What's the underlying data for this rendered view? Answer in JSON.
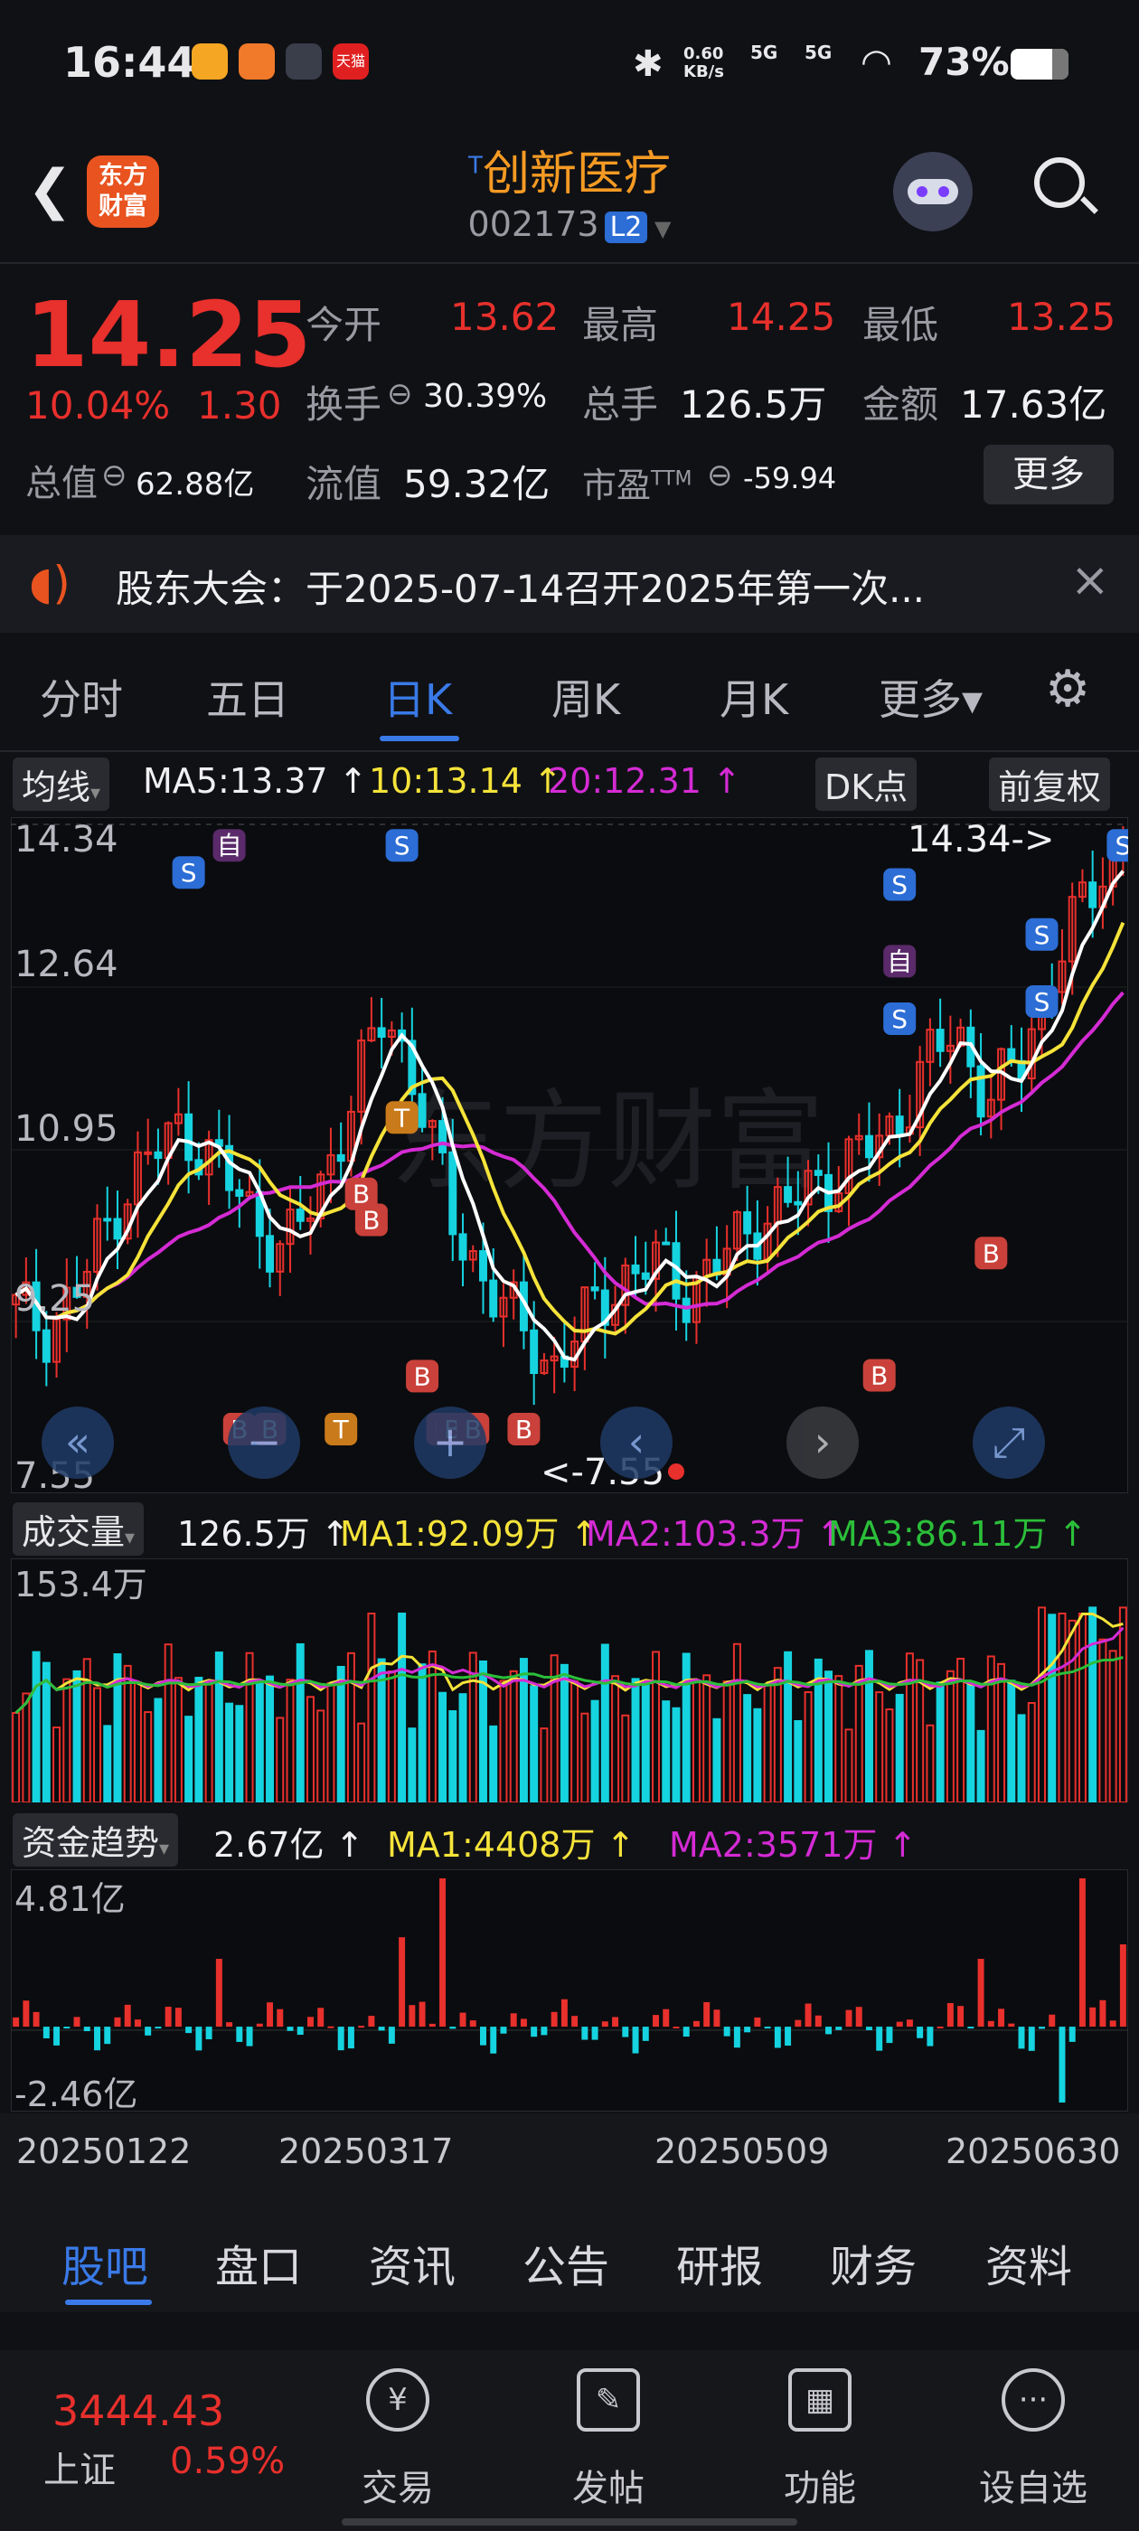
{
  "status_bar": {
    "time": "16:44",
    "network_speed": "0.60 KB/s",
    "signal1": "5G",
    "signal2": "5G",
    "battery": "73%",
    "tmall_label": "天猫"
  },
  "header": {
    "logo_text_line1": "东方",
    "logo_text_line2": "财富",
    "superscript": "T",
    "stock_name": "创新医疗",
    "stock_code": "002173",
    "level_badge": "L2"
  },
  "quote": {
    "price": "14.25",
    "change_pct": "10.04%",
    "change_amt": "1.30",
    "open_label": "今开",
    "open": "13.62",
    "high_label": "最高",
    "high": "14.25",
    "low_label": "最低",
    "low": "13.25",
    "turnover_label": "换手",
    "turnover": "30.39%",
    "volume_label": "总手",
    "volume": "126.5万",
    "amount_label": "金额",
    "amount": "17.63亿",
    "total_mv_label": "总值",
    "total_mv": "62.88亿",
    "float_mv_label": "流值",
    "float_mv": "59.32亿",
    "pe_label": "市盈",
    "pe_super": "TTM",
    "pe": "-59.94",
    "more_button": "更多"
  },
  "notice": {
    "text": "股东大会：于2025-07-14召开2025年第一次..."
  },
  "period_tabs": [
    {
      "label": "分时",
      "active": false
    },
    {
      "label": "五日",
      "active": false
    },
    {
      "label": "日K",
      "active": true
    },
    {
      "label": "周K",
      "active": false
    },
    {
      "label": "月K",
      "active": false
    },
    {
      "label": "更多▾",
      "active": false
    }
  ],
  "kline_header": {
    "indicator": "均线",
    "ma5": "MA5:13.37 ↑",
    "ma10": "10:13.14 ↑",
    "ma20": "20:12.31 ↑",
    "dk_button": "DK点",
    "adjust_button": "前复权"
  },
  "kline_axis": {
    "y1": "14.34",
    "y2": "12.64",
    "y3": "10.95",
    "y4": "9.25",
    "y5": "7.55",
    "high_marker": "14.34->",
    "low_marker": "<-7.55"
  },
  "volume_header": {
    "indicator": "成交量",
    "value": "126.5万 ↑",
    "ma1": "MA1:92.09万 ↑",
    "ma2": "MA2:103.3万 ↑",
    "ma3": "MA3:86.11万 ↑",
    "y_max": "153.4万"
  },
  "fund_header": {
    "indicator": "资金趋势",
    "value": "2.67亿 ↑",
    "ma1": "MA1:4408万 ↑",
    "ma2": "MA2:3571万 ↑",
    "y_max": "4.81亿",
    "y_min": "-2.46亿"
  },
  "date_axis": [
    "20250122",
    "20250317",
    "20250509",
    "20250630"
  ],
  "watermark": "东方财富",
  "bottom_tabs": [
    {
      "label": "股吧",
      "active": true
    },
    {
      "label": "盘口",
      "active": false
    },
    {
      "label": "资讯",
      "active": false
    },
    {
      "label": "公告",
      "active": false
    },
    {
      "label": "研报",
      "active": false
    },
    {
      "label": "财务",
      "active": false
    },
    {
      "label": "资料",
      "active": false
    }
  ],
  "bottom_nav": {
    "index_value": "3444.43",
    "index_name": "上证",
    "index_change": "0.59%",
    "trade": "交易",
    "post": "发帖",
    "function": "功能",
    "watchlist": "设自选"
  },
  "colors": {
    "up": "#e8302c",
    "down": "#16d3e0",
    "ma5": "#ffffff",
    "ma10": "#f5e33a",
    "ma20": "#d42bd4",
    "accent": "#3a7ae8",
    "brand": "#e8531f"
  },
  "chart_data": {
    "type": "candlestick",
    "x_range": [
      "20250122",
      "20250630"
    ],
    "ylim": [
      7.55,
      14.34
    ],
    "approx_close": [
      9.3,
      9.1,
      9.6,
      10.4,
      10.9,
      11.2,
      10.8,
      10.3,
      9.9,
      10.5,
      11.5,
      12.4,
      11.6,
      10.2,
      9.6,
      9.1,
      8.7,
      9.2,
      9.6,
      9.8,
      9.5,
      9.8,
      10.2,
      10.4,
      10.6,
      10.9,
      11.1,
      11.8,
      12.2,
      11.5,
      11.9,
      13.0,
      13.6,
      14.25
    ],
    "volume_ymax": "153.4万",
    "fund_range": [
      -2.46,
      4.81
    ]
  }
}
